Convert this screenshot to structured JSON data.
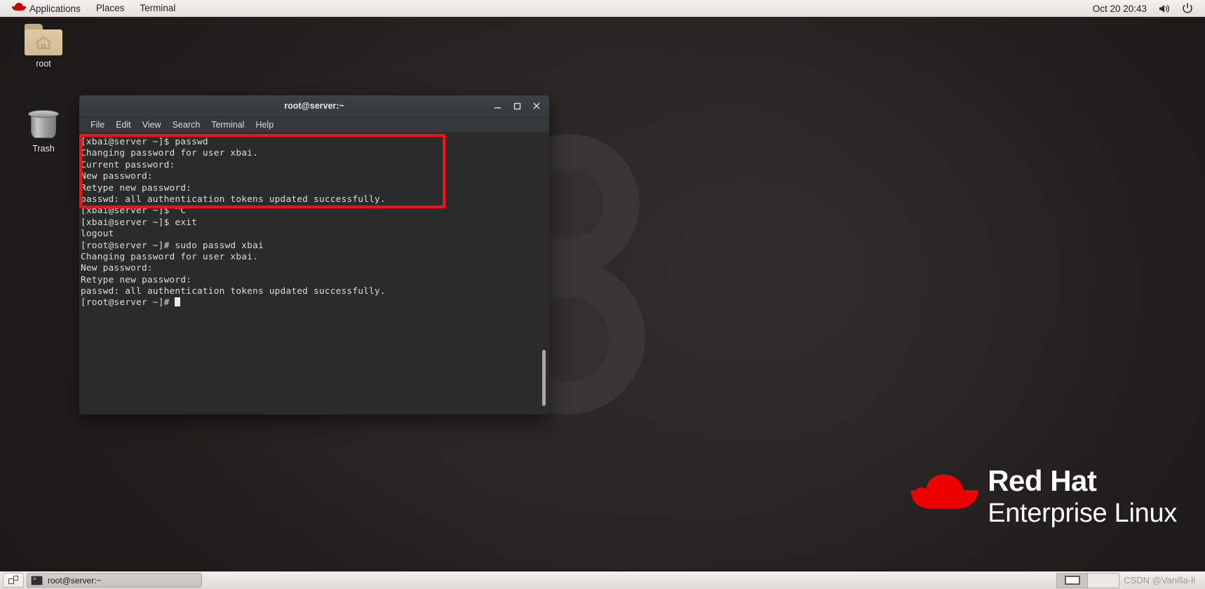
{
  "topbar": {
    "logo_icon": "redhat-fedora-icon",
    "menus": [
      {
        "label": "Applications"
      },
      {
        "label": "Places"
      },
      {
        "label": "Terminal"
      }
    ],
    "clock": "Oct 20  20:43",
    "volume_icon": "volume-icon",
    "power_icon": "power-icon"
  },
  "desktop": {
    "icons": [
      {
        "label": "root",
        "icon": "home-folder-icon"
      },
      {
        "label": "Trash",
        "icon": "trash-can-icon"
      }
    ],
    "brand": {
      "logo_icon": "redhat-hat-logo-icon",
      "line1": "Red Hat",
      "line2": "Enterprise Linux"
    }
  },
  "terminal": {
    "title": "root@server:~",
    "window_buttons": {
      "minimize": "–",
      "maximize": "☐",
      "close": "✕"
    },
    "menus": [
      {
        "label": "File"
      },
      {
        "label": "Edit"
      },
      {
        "label": "View"
      },
      {
        "label": "Search"
      },
      {
        "label": "Terminal"
      },
      {
        "label": "Help"
      }
    ],
    "lines": [
      "[xbai@server ~]$ passwd",
      "Changing password for user xbai.",
      "Current password:",
      "New password:",
      "Retype new password:",
      "passwd: all authentication tokens updated successfully.",
      "[xbai@server ~]$ ^C",
      "[xbai@server ~]$ exit",
      "logout",
      "[root@server ~]# sudo passwd xbai",
      "Changing password for user xbai.",
      "New password:",
      "Retype new password:",
      "passwd: all authentication tokens updated successfully."
    ],
    "prompt_last": "[root@server ~]# ",
    "highlight_color": "#fc0d1b",
    "highlight_first_line": 0,
    "highlight_last_line": 5
  },
  "taskbar": {
    "show_desktop_icon": "show-desktop-icon",
    "window_button": {
      "label": "root@server:~",
      "icon": "terminal-icon"
    },
    "workspaces": [
      {
        "name": "workspace-1",
        "active": true
      },
      {
        "name": "workspace-2",
        "active": false
      }
    ],
    "watermark": "CSDN @Vanilla-li"
  }
}
